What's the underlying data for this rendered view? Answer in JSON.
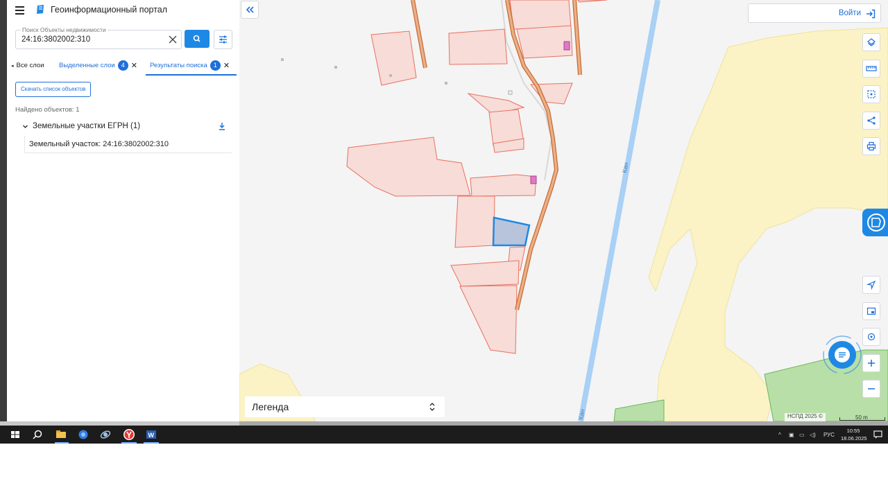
{
  "app": {
    "title": "Геоинформационный портал"
  },
  "search": {
    "placeholder_label": "Поиск Объекты недвижимости",
    "value": "24:16:3802002:310"
  },
  "tabs": [
    {
      "label": "Все слои",
      "badge": null,
      "closable": false,
      "active": false
    },
    {
      "label": "Выделенные слои",
      "badge": "4",
      "closable": true,
      "active": false
    },
    {
      "label": "Результаты поиска",
      "badge": "1",
      "closable": true,
      "active": true
    }
  ],
  "results": {
    "download_list_label": "Скачать список объектов",
    "found_label": "Найдено объектов: 1",
    "group_label": "Земельные участки ЕГРН (1)",
    "item_label": "Земельный участок: 24:16:3802002:310"
  },
  "map": {
    "login_label": "Войти",
    "legend_label": "Легенда",
    "river_label": "Кан",
    "attribution": "НСПД 2025 ©",
    "scale_label": "50 m",
    "colors": {
      "parcel_fill": "#f7dcd8",
      "parcel_stroke": "#e8705f",
      "selected_fill": "#b8c4dc",
      "selected_stroke": "#1e88e5",
      "road": "#e9a877",
      "river": "#a9d0f5",
      "zone_yellow": "#fbf3c6",
      "zone_green": "#b8dfa8",
      "accent": "#1e88e5"
    }
  },
  "taskbar": {
    "lang": "РУС",
    "time": "10:55",
    "date": "18.06.2025"
  }
}
